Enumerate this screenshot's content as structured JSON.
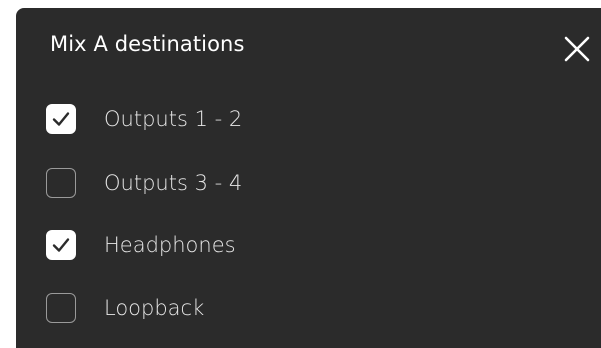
{
  "dialog": {
    "title": "Mix A destinations",
    "close_icon": "close-icon",
    "options": [
      {
        "label": "Outputs 1 - 2",
        "checked": true
      },
      {
        "label": "Outputs 3 - 4",
        "checked": false
      },
      {
        "label": "Headphones",
        "checked": true
      },
      {
        "label": "Loopback",
        "checked": false
      }
    ]
  },
  "colors": {
    "panel_background": "#2b2b2b",
    "text": "#ffffff",
    "checkbox_checked": "#ffffff",
    "checkbox_border": "#9a9a9a",
    "checkmark": "#2b2b2b"
  }
}
